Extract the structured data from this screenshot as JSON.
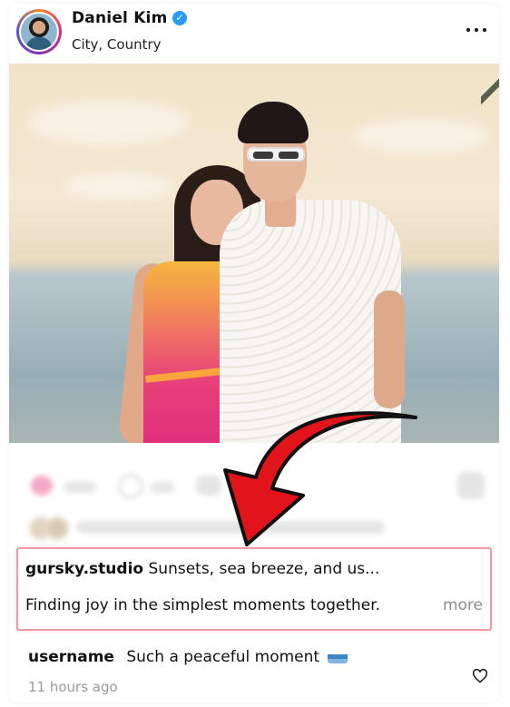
{
  "post": {
    "author": "Daniel Kim",
    "verified_glyph": "✓",
    "location": "City, Country",
    "more_menu_icon": "more-horizontal-icon"
  },
  "caption": {
    "username": "gursky.studio",
    "line1": "Sunsets, sea breeze, and us...",
    "line2": "Finding joy in the simplest moments together.",
    "more": "more"
  },
  "comment": {
    "username": "username",
    "text": "Such a peaceful moment",
    "emoji_icon": "wave-icon",
    "time": "11 hours ago"
  },
  "colors": {
    "highlight_border": "#ef9aa6",
    "arrow": "#e2141b",
    "verified": "#2b9af3"
  }
}
